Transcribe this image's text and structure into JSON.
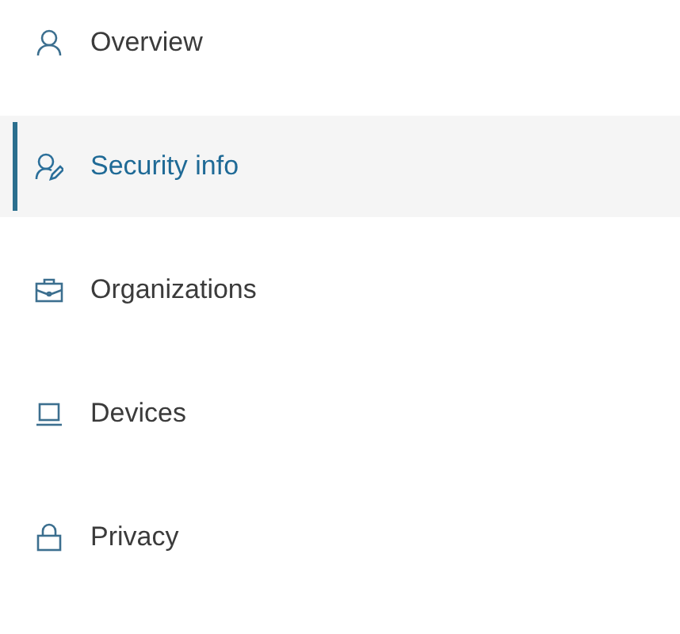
{
  "sidebar": {
    "items": [
      {
        "label": "Overview",
        "kind": "profile",
        "selected": false
      },
      {
        "label": "Security info",
        "kind": "security",
        "selected": true
      },
      {
        "label": "Organizations",
        "kind": "organizations",
        "selected": false
      },
      {
        "label": "Devices",
        "kind": "devices",
        "selected": false
      },
      {
        "label": "Privacy",
        "kind": "privacy",
        "selected": false
      }
    ]
  }
}
